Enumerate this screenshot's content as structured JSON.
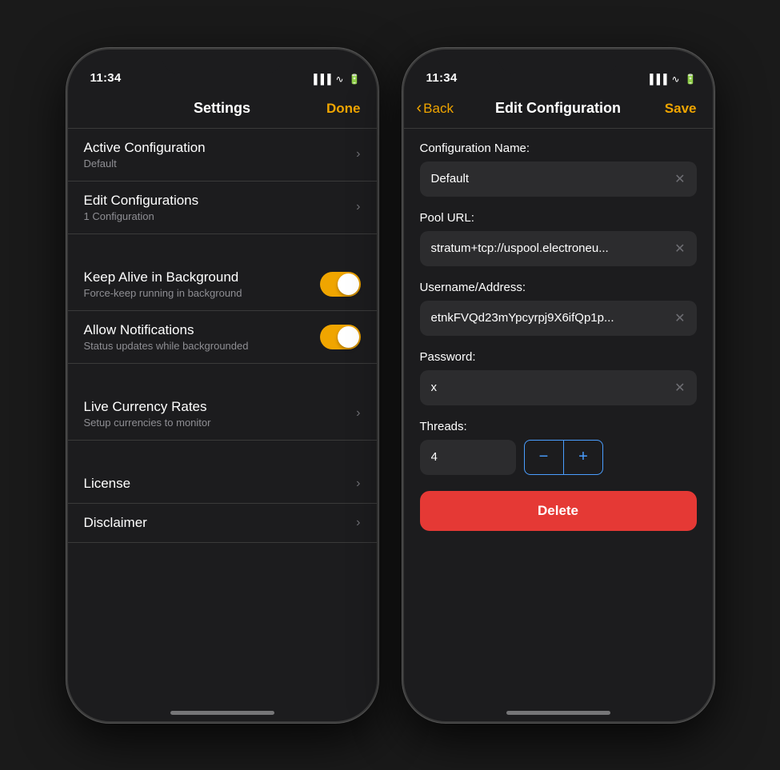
{
  "phone1": {
    "statusBar": {
      "time": "11:34"
    },
    "navBar": {
      "title": "Settings",
      "actionLabel": "Done"
    },
    "settings": {
      "sections": [
        {
          "items": [
            {
              "title": "Active Configuration",
              "subtitle": "Default",
              "type": "chevron"
            },
            {
              "title": "Edit Configurations",
              "subtitle": "1 Configuration",
              "type": "chevron"
            }
          ]
        },
        {
          "items": [
            {
              "title": "Keep Alive in Background",
              "subtitle": "Force-keep running in background",
              "type": "toggle",
              "value": true
            },
            {
              "title": "Allow Notifications",
              "subtitle": "Status updates while backgrounded",
              "type": "toggle",
              "value": true
            }
          ]
        },
        {
          "items": [
            {
              "title": "Live Currency Rates",
              "subtitle": "Setup currencies to monitor",
              "type": "chevron"
            }
          ]
        },
        {
          "items": [
            {
              "title": "License",
              "subtitle": "",
              "type": "chevron"
            },
            {
              "title": "Disclaimer",
              "subtitle": "",
              "type": "chevron"
            }
          ]
        }
      ]
    }
  },
  "phone2": {
    "statusBar": {
      "time": "11:34"
    },
    "navBar": {
      "title": "Edit Configuration",
      "backLabel": "Back",
      "saveLabel": "Save"
    },
    "form": {
      "configNameLabel": "Configuration Name:",
      "configNameValue": "Default",
      "poolUrlLabel": "Pool URL:",
      "poolUrlValue": "stratum+tcp://uspool.electroneu...",
      "usernameLabel": "Username/Address:",
      "usernameValue": "etnkFVQd23mYpcyrpj9X6ifQp1p...",
      "passwordLabel": "Password:",
      "passwordValue": "x",
      "threadsLabel": "Threads:",
      "threadsValue": "4",
      "decrementLabel": "−",
      "incrementLabel": "+",
      "deleteLabel": "Delete"
    }
  }
}
